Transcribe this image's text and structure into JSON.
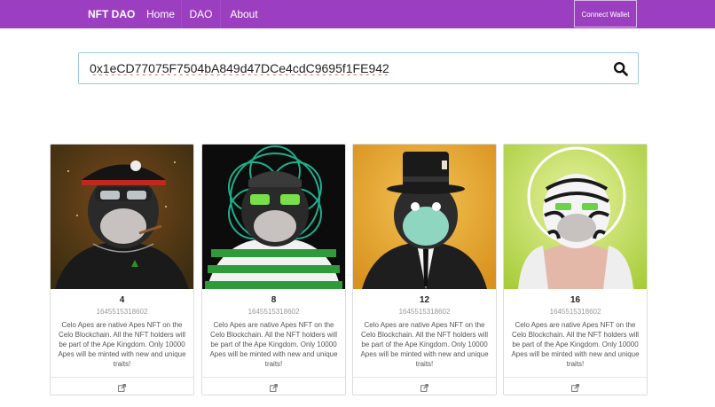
{
  "navbar": {
    "brand": "NFT DAO",
    "items": [
      {
        "label": "Home"
      },
      {
        "label": "DAO"
      },
      {
        "label": "About"
      }
    ],
    "connect_label": "Connect Wallet",
    "background": "#9b3fc0"
  },
  "search": {
    "value": "0x1eCD77075F7504bA849d47DCe4cdC9695f1FE942",
    "icon": "search-icon"
  },
  "cards": [
    {
      "number": "4",
      "timestamp": "1645515318602",
      "description": "Celo Apes are native Apes NFT on the Celo Blockchain. All the NFT holders will be part of the Ape Kingdom. Only 10000 Apes will be minted with new and unique traits!",
      "icon": "external-link-icon"
    },
    {
      "number": "8",
      "timestamp": "1645515318602",
      "description": "Celo Apes are native Apes NFT on the Celo Blockchain. All the NFT holders will be part of the Ape Kingdom. Only 10000 Apes will be minted with new and unique traits!",
      "icon": "external-link-icon"
    },
    {
      "number": "12",
      "timestamp": "1645515318602",
      "description": "Celo Apes are native Apes NFT on the Celo Blockchain. All the NFT holders will be part of the Ape Kingdom. Only 10000 Apes will be minted with new and unique traits!",
      "icon": "external-link-icon"
    },
    {
      "number": "16",
      "timestamp": "1645515318602",
      "description": "Celo Apes are native Apes NFT on the Celo Blockchain. All the NFT holders will be part of the Ape Kingdom. Only 10000 Apes will be minted with new and unique traits!",
      "icon": "external-link-icon"
    }
  ]
}
